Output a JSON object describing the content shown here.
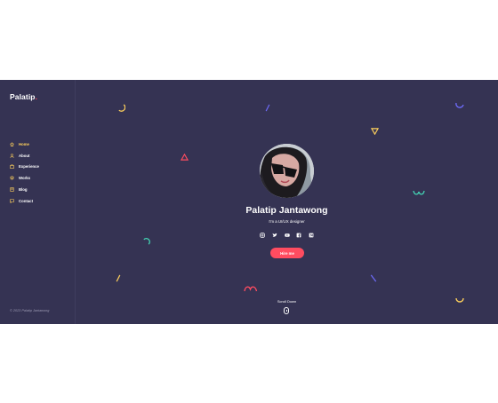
{
  "brand": {
    "name": "Palatip",
    "dot": "."
  },
  "nav": {
    "items": [
      {
        "label": "Home",
        "icon": "house-icon",
        "active": true
      },
      {
        "label": "About",
        "icon": "user-icon"
      },
      {
        "label": "Experience",
        "icon": "briefcase-icon"
      },
      {
        "label": "Works",
        "icon": "layers-icon"
      },
      {
        "label": "Blog",
        "icon": "note-icon"
      },
      {
        "label": "Contact",
        "icon": "chat-icon"
      }
    ]
  },
  "footer": {
    "copyright": "© 2023 Palatip Jantawong"
  },
  "hero": {
    "name": "Palatip Jantawong",
    "role": "I'm a UI/UX designer",
    "cta": "Hire me",
    "scroll": "Scroll Down",
    "social": [
      "instagram-icon",
      "twitter-icon",
      "youtube-icon",
      "facebook-icon",
      "medium-icon"
    ]
  },
  "colors": {
    "background": "#353353",
    "accent": "#ff4c60",
    "highlight": "#ffd15c",
    "text": "#ffffff",
    "muted": "#9c9ab3"
  }
}
